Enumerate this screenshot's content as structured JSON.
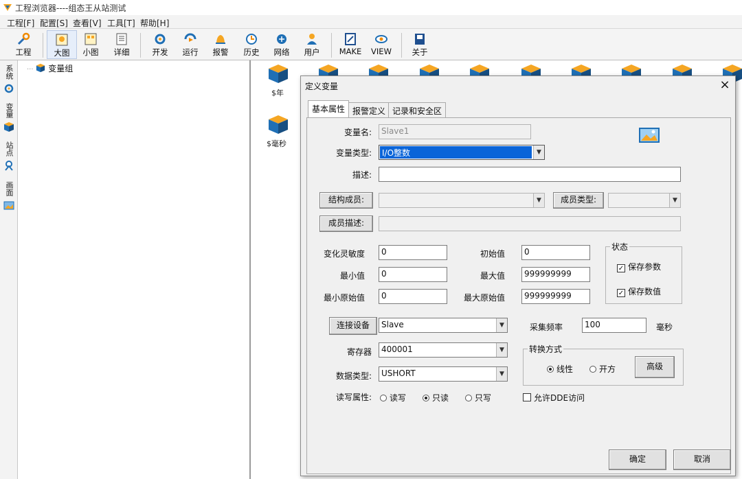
{
  "window": {
    "title": "工程浏览器----组态王从站测试"
  },
  "menu": [
    "工程[F]",
    "配置[S]",
    "查看[V]",
    "工具[T]",
    "帮助[H]"
  ],
  "toolbar": {
    "project": "工程",
    "large_icon": "大图",
    "small_icon": "小图",
    "detail": "详细",
    "develop": "开发",
    "run": "运行",
    "alarm": "报警",
    "history": "历史",
    "network": "网络",
    "user": "用户",
    "make": "MAKE",
    "view": "VIEW",
    "about": "关于"
  },
  "vtabs": [
    "系统",
    "变量",
    "站点",
    "画面"
  ],
  "tree": {
    "root": "变量组"
  },
  "grid": {
    "items": [
      "$年",
      "$毫秒"
    ]
  },
  "dialog": {
    "title": "定义变量",
    "close": "×",
    "tabs": [
      "基本属性",
      "报警定义",
      "记录和安全区"
    ],
    "var_name_label": "变量名:",
    "var_name_value": "Slave1",
    "var_type_label": "变量类型:",
    "var_type_value": "I/O整数",
    "desc_label": "描述:",
    "desc_value": "",
    "struct_member_label": "结构成员:",
    "member_type_label": "成员类型:",
    "member_desc_label": "成员描述:",
    "change_sens_label": "变化灵敏度",
    "change_sens_value": "0",
    "initial_label": "初始值",
    "initial_value": "0",
    "min_label": "最小值",
    "min_value": "0",
    "max_label": "最大值",
    "max_value": "999999999",
    "min_raw_label": "最小原始值",
    "min_raw_value": "0",
    "max_raw_label": "最大原始值",
    "max_raw_value": "999999999",
    "state_group": "状态",
    "save_params": "保存参数",
    "save_values": "保存数值",
    "connect_device_btn": "连接设备",
    "device_value": "Slave",
    "sample_label": "采集频率",
    "sample_value": "100",
    "sample_unit": "毫秒",
    "register_label": "寄存器",
    "register_value": "400001",
    "datatype_label": "数据类型:",
    "datatype_value": "USHORT",
    "convert_group": "转换方式",
    "linear": "线性",
    "sqrt": "开方",
    "advanced": "高级",
    "rw_label": "读写属性:",
    "rw_readwrite": "读写",
    "rw_readonly": "只读",
    "rw_writeonly": "只写",
    "allow_dde": "允许DDE访问",
    "ok": "确定",
    "cancel": "取消"
  },
  "colors": {
    "cube_top": "#f5a623",
    "cube_side": "#1f6fb5",
    "selection": "#0a64d8"
  }
}
